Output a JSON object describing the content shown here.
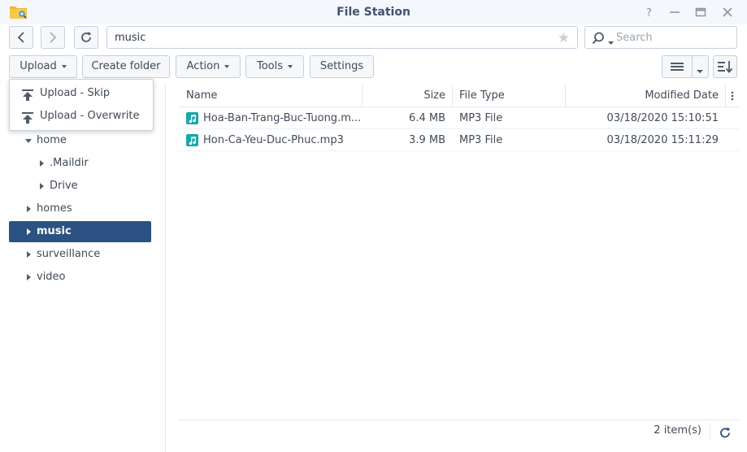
{
  "window": {
    "title": "File Station",
    "app_icon": "folder-search-icon",
    "controls": [
      "help-icon",
      "minimize-icon",
      "maximize-icon",
      "close-icon"
    ]
  },
  "nav": {
    "back_icon": "chevron-left-icon",
    "forward_icon": "chevron-right-icon",
    "refresh_icon": "refresh-icon",
    "path": "music",
    "favorite_icon": "star-icon",
    "search_placeholder": "Search"
  },
  "toolbar": {
    "upload_label": "Upload",
    "create_folder_label": "Create folder",
    "action_label": "Action",
    "tools_label": "Tools",
    "settings_label": "Settings",
    "view_icon": "list-view-icon",
    "sort_icon": "sort-icon"
  },
  "upload_menu": {
    "items": [
      {
        "label": "Upload - Skip",
        "icon": "upload-icon"
      },
      {
        "label": "Upload - Overwrite",
        "icon": "upload-icon"
      }
    ]
  },
  "sidebar": {
    "items": [
      {
        "label": "home",
        "expanded": true
      },
      {
        "label": ".Maildir",
        "expanded": false
      },
      {
        "label": "Drive",
        "expanded": false
      },
      {
        "label": "homes",
        "expanded": false
      },
      {
        "label": "music",
        "expanded": false,
        "selected": true
      },
      {
        "label": "surveillance",
        "expanded": false
      },
      {
        "label": "video",
        "expanded": false
      }
    ]
  },
  "filelist": {
    "columns": {
      "name": "Name",
      "size": "Size",
      "type": "File Type",
      "modified": "Modified Date"
    },
    "rows": [
      {
        "name": "Hoa-Ban-Trang-Buc-Tuong.m...",
        "size": "6.4 MB",
        "type": "MP3 File",
        "modified": "03/18/2020 15:10:51",
        "icon": "music-file-icon"
      },
      {
        "name": "Hon-Ca-Yeu-Duc-Phuc.mp3",
        "size": "3.9 MB",
        "type": "MP3 File",
        "modified": "03/18/2020 15:11:29",
        "icon": "music-file-icon"
      }
    ],
    "status": "2 item(s)"
  },
  "colors": {
    "accent": "#2c5283",
    "title_text": "#405370",
    "mp3_icon": "#18a7a8",
    "folder_icon": "#f0b533"
  }
}
